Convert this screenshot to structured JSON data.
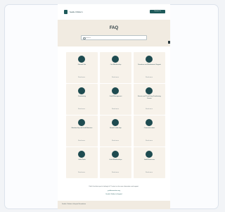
{
  "header": {
    "logo_text": "Seattle Children's",
    "cta_label": "Contact Us"
  },
  "hero": {
    "title": "FAQ",
    "search_placeholder": "Search"
  },
  "cards": [
    {
      "title": "General Info",
      "link": "Read more"
    },
    {
      "title": "Our Membership",
      "link": "Read more"
    },
    {
      "title": "Donations and Endowment Support",
      "link": "Read more"
    },
    {
      "title": "Fundraising",
      "link": "Read more"
    },
    {
      "title": "Guild Management",
      "link": "Read more"
    },
    {
      "title": "Events and Third-Party Fundraising Events",
      "link": "Read more"
    },
    {
      "title": "Membership and Guild Statistics",
      "link": "Read more"
    },
    {
      "title": "Board Leadership",
      "link": "Read more"
    },
    {
      "title": "Communications",
      "link": "Read more"
    },
    {
      "title": "Guild Tools",
      "link": "Read more"
    },
    {
      "title": "Guild Memberships",
      "link": "Read more"
    },
    {
      "title": "Guild Resources",
      "link": "Read more"
    }
  ],
  "footer": {
    "note": "Didn't find what you're looking for? Contact us for more information and support.",
    "link_primary": "guildassociation.org",
    "link_secondary": "Seattle Children's Hospital"
  },
  "bottom_bar": {
    "text": "Seattle Children's Hospital Foundation"
  },
  "colors": {
    "accent": "#1e5a5a",
    "hero_bg": "#f1ebe1",
    "card_bg": "#f7f2ea"
  }
}
